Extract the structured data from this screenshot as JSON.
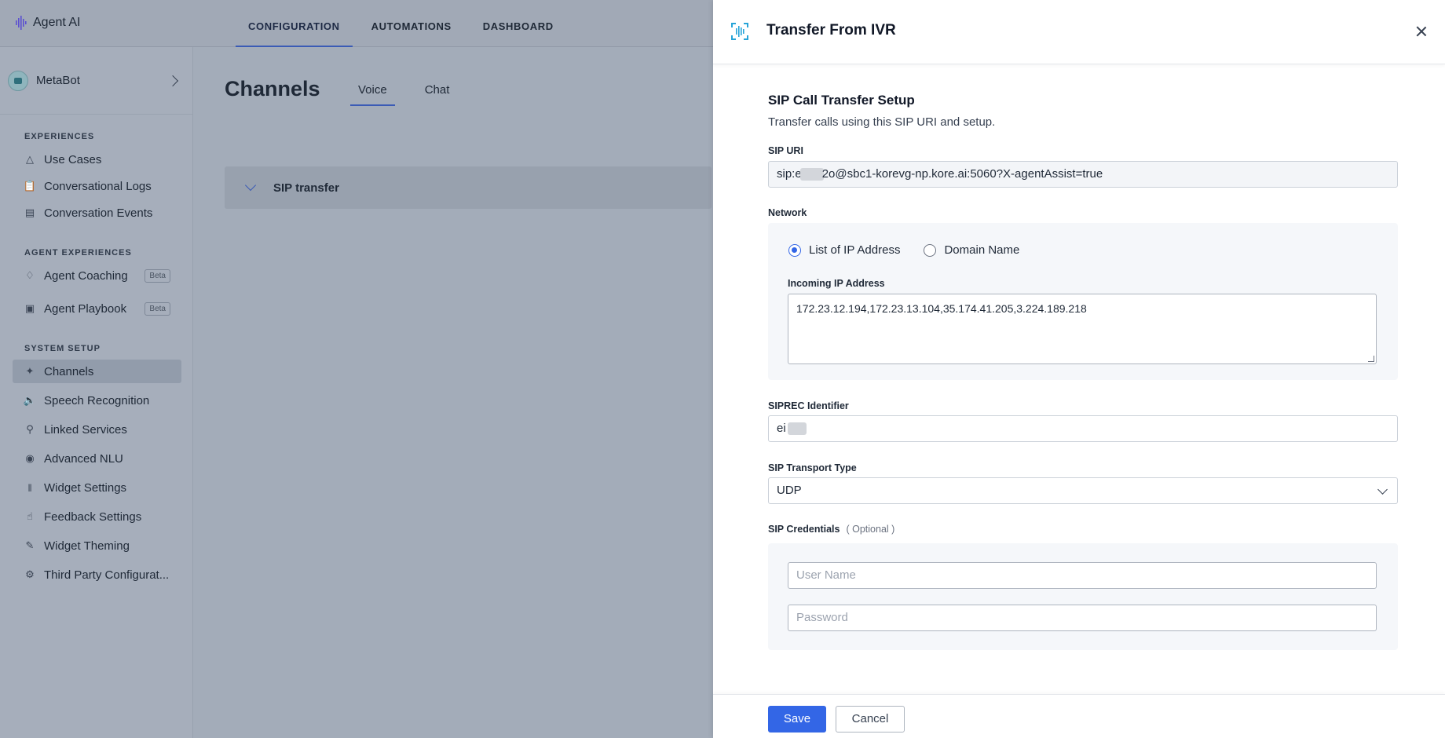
{
  "app": {
    "logo_text": "Agent AI",
    "top_nav": [
      "CONFIGURATION",
      "AUTOMATIONS",
      "DASHBOARD"
    ],
    "active_nav": "CONFIGURATION"
  },
  "sidebar": {
    "bot_name": "MetaBot",
    "sections": [
      {
        "title": "EXPERIENCES",
        "items": [
          {
            "label": "Use Cases",
            "icon": "use-cases-icon"
          },
          {
            "label": "Conversational Logs",
            "icon": "logs-icon"
          },
          {
            "label": "Conversation Events",
            "icon": "events-icon"
          }
        ]
      },
      {
        "title": "AGENT EXPERIENCES",
        "items": [
          {
            "label": "Agent Coaching",
            "icon": "coaching-icon",
            "badge": "Beta"
          },
          {
            "label": "Agent Playbook",
            "icon": "playbook-icon",
            "badge": "Beta"
          }
        ]
      },
      {
        "title": "SYSTEM SETUP",
        "items": [
          {
            "label": "Channels",
            "icon": "channels-icon",
            "active": true
          },
          {
            "label": "Speech Recognition",
            "icon": "speech-icon"
          },
          {
            "label": "Linked Services",
            "icon": "search-icon"
          },
          {
            "label": "Advanced NLU",
            "icon": "nlu-icon"
          },
          {
            "label": "Widget Settings",
            "icon": "waveform-icon"
          },
          {
            "label": "Feedback Settings",
            "icon": "thumbs-up-icon"
          },
          {
            "label": "Widget Theming",
            "icon": "brush-icon"
          },
          {
            "label": "Third Party Configurat...",
            "icon": "gear-icon"
          }
        ]
      }
    ]
  },
  "main": {
    "title": "Channels",
    "tabs": [
      "Voice",
      "Chat"
    ],
    "active_tab": "Voice",
    "card_label": "SIP transfer"
  },
  "drawer": {
    "title": "Transfer From IVR",
    "setup_title": "SIP Call Transfer Setup",
    "setup_desc": "Transfer calls using this SIP URI and setup.",
    "sip_uri_label": "SIP URI",
    "sip_uri_prefix": "sip:e",
    "sip_uri_suffix": "2o@sbc1-korevg-np.kore.ai:5060?X-agentAssist=true",
    "network_label": "Network",
    "network_options": [
      "List of IP Address",
      "Domain Name"
    ],
    "network_selected": "List of IP Address",
    "incoming_ip_label": "Incoming IP Address",
    "incoming_ip_value": "172.23.12.194,172.23.13.104,35.174.41.205,3.224.189.218",
    "siprec_label": "SIPREC Identifier",
    "siprec_prefix": "ei",
    "transport_label": "SIP Transport Type",
    "transport_value": "UDP",
    "credentials_label": "SIP Credentials",
    "credentials_optional": "( Optional )",
    "username_placeholder": "User Name",
    "password_placeholder": "Password",
    "save_label": "Save",
    "cancel_label": "Cancel"
  },
  "colors": {
    "accent": "#3366e6",
    "overlay": "#a3acb9"
  }
}
